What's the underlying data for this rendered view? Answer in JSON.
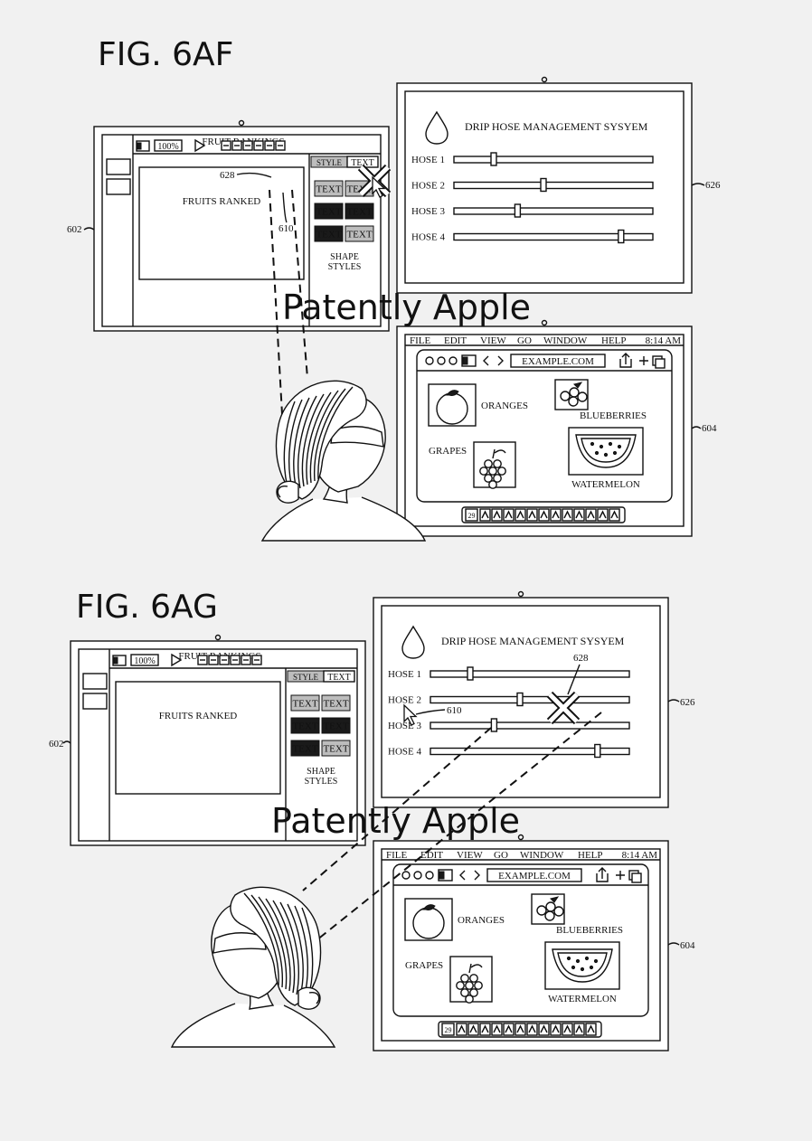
{
  "figures": [
    {
      "title": "FIG. 6AF",
      "left_display": {
        "ref": "602",
        "doc_title": "FRUIT RANKINGS",
        "zoom": "100%",
        "canvas_text": "FRUITS RANKED",
        "tabs": [
          "STYLE",
          "TEXT"
        ],
        "style_buttons": [
          "TEXT",
          "TEXT",
          "TEXT",
          "TEXT",
          "TEXT",
          "TEXT"
        ],
        "styles_caption": [
          "SHAPE",
          "STYLES"
        ],
        "marker_ref": "628",
        "pointer_ref": "610"
      },
      "top_right_display": {
        "ref": "626",
        "title": "DRIP HOSE MANAGEMENT SYSYEM",
        "hoses": [
          {
            "label": "HOSE 1",
            "level": 0.2
          },
          {
            "label": "HOSE 2",
            "level": 0.45
          },
          {
            "label": "HOSE 3",
            "level": 0.32
          },
          {
            "label": "HOSE 4",
            "level": 0.84
          }
        ]
      },
      "bottom_right_display": {
        "ref": "604",
        "menu": [
          "FILE",
          "EDIT",
          "VIEW",
          "GO",
          "WINDOW",
          "HELP"
        ],
        "time": "8:14 AM",
        "url": "EXAMPLE.COM",
        "fruits": [
          "ORANGES",
          "BLUEBERRIES",
          "GRAPES",
          "WATERMELON"
        ],
        "dock_badge": "29"
      },
      "watermark": "Patently Apple"
    },
    {
      "title": "FIG. 6AG",
      "left_display": {
        "ref": "602",
        "doc_title": "FRUIT RANKINGS",
        "zoom": "100%",
        "canvas_text": "FRUITS RANKED",
        "tabs": [
          "STYLE",
          "TEXT"
        ],
        "style_buttons": [
          "TEXT",
          "TEXT",
          "TEXT",
          "TEXT",
          "TEXT",
          "TEXT"
        ],
        "styles_caption": [
          "SHAPE",
          "STYLES"
        ]
      },
      "top_right_display": {
        "ref": "626",
        "title": "DRIP HOSE MANAGEMENT SYSYEM",
        "marker_ref": "628",
        "pointer_ref": "610",
        "hoses": [
          {
            "label": "HOSE 1",
            "level": 0.2
          },
          {
            "label": "HOSE 2",
            "level": 0.45
          },
          {
            "label": "HOSE 3",
            "level": 0.32
          },
          {
            "label": "HOSE 4",
            "level": 0.84
          }
        ]
      },
      "bottom_right_display": {
        "ref": "604",
        "menu": [
          "FILE",
          "EDIT",
          "VIEW",
          "GO",
          "WINDOW",
          "HELP"
        ],
        "time": "8:14 AM",
        "url": "EXAMPLE.COM",
        "fruits": [
          "ORANGES",
          "BLUEBERRIES",
          "GRAPES",
          "WATERMELON"
        ],
        "dock_badge": "29"
      },
      "watermark": "Patently Apple"
    }
  ]
}
